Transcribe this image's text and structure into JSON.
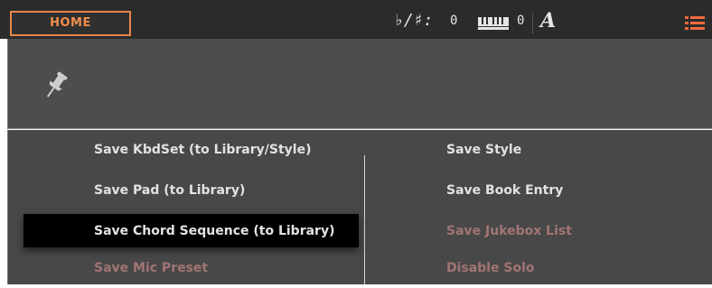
{
  "header": {
    "home_tab": "HOME",
    "flat_sharp_label": "♭/♯:",
    "flat_sharp_value": "0",
    "keyboard_value": "0",
    "font_indicator": "A",
    "menu_icon": "list-menu-icon",
    "accent_color": "#ef8e4c"
  },
  "pin": {
    "icon": "pushpin-icon"
  },
  "menu": {
    "left": [
      {
        "label": "Save KbdSet (to Library/Style)",
        "enabled": true
      },
      {
        "label": "Save Pad (to Library)",
        "enabled": true
      },
      {
        "label": "Save Chord Sequence (to Library)",
        "enabled": true,
        "selected": true
      },
      {
        "label": "Save Mic Preset",
        "enabled": false
      }
    ],
    "right": [
      {
        "label": "Save Style",
        "enabled": true
      },
      {
        "label": "Save Book Entry",
        "enabled": true
      },
      {
        "label": "Save Jukebox List",
        "enabled": false
      },
      {
        "label": "Disable Solo",
        "enabled": false
      }
    ],
    "colors": {
      "enabled": "#e2e2e2",
      "disabled": "#a27474",
      "selected_bg": "#000000"
    }
  }
}
